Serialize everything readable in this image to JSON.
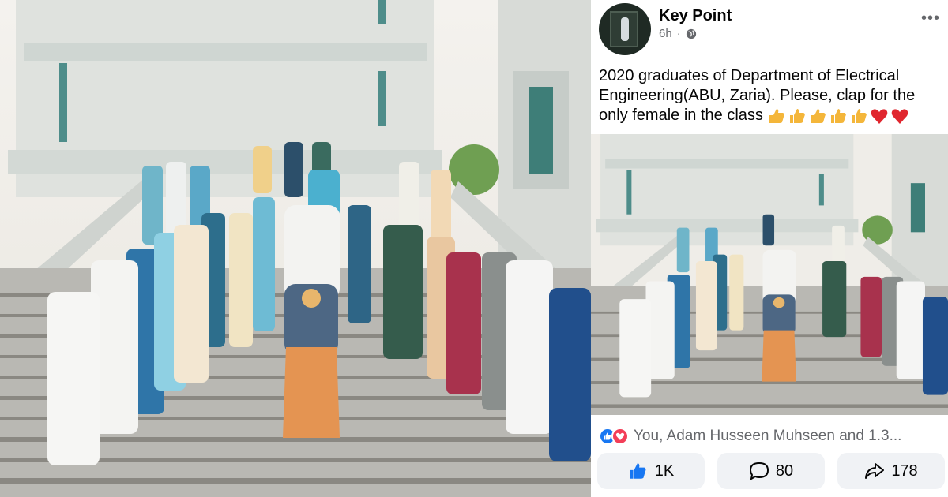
{
  "post": {
    "page_name": "Key Point",
    "time": "6h",
    "separator": "·",
    "more": "•••",
    "text": "2020 graduates of Department of Electrical Engineering(ABU, Zaria). Please, clap for the only female in the class",
    "emoji": [
      "thumbs-up",
      "thumbs-up",
      "thumbs-up",
      "thumbs-up",
      "thumbs-up",
      "red-heart",
      "red-heart"
    ],
    "reactions_text": "You, Adam Husseen Muhseen and 1.3...",
    "like_count": "1K",
    "comment_count": "80",
    "share_count": "178"
  },
  "colors": {
    "facebook_blue": "#1877f2",
    "love_red": "#f33e58",
    "button_bg": "#f0f2f5",
    "meta_gray": "#65676b"
  }
}
